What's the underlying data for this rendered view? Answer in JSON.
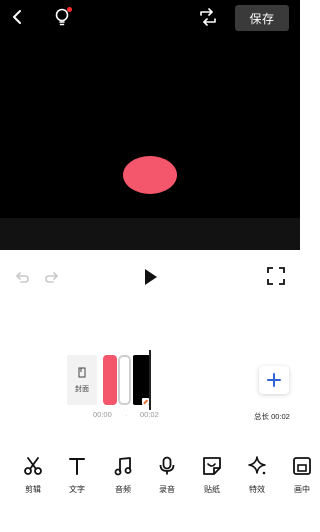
{
  "header": {
    "save_label": "保存"
  },
  "timeline": {
    "cover_label": "封面",
    "time_start": "00:00",
    "time_separator": "·",
    "time_end": "00:02",
    "total_length": "总长 00:02"
  },
  "toolbar": {
    "items": [
      {
        "label": "剪辑",
        "icon": "scissors-icon"
      },
      {
        "label": "文字",
        "icon": "text-icon"
      },
      {
        "label": "音频",
        "icon": "music-note-icon"
      },
      {
        "label": "录音",
        "icon": "microphone-icon"
      },
      {
        "label": "贴纸",
        "icon": "sticker-icon"
      },
      {
        "label": "特效",
        "icon": "sparkle-icon"
      },
      {
        "label": "画中",
        "icon": "picture-in-picture-icon"
      }
    ]
  },
  "colors": {
    "accent_blob": "#f4566c",
    "add_button_plus": "#2f63d6",
    "notification_dot": "#ff2d2d"
  }
}
